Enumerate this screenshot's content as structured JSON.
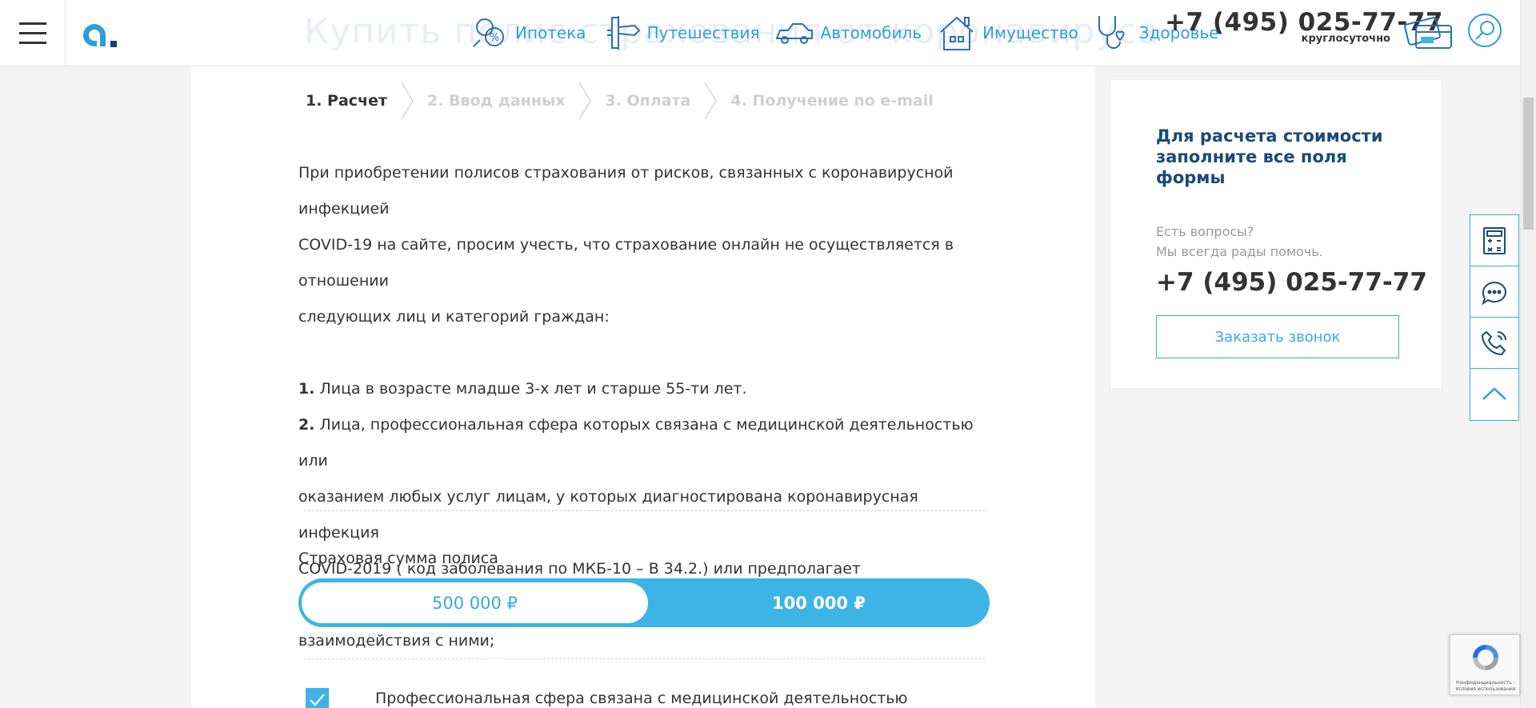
{
  "header": {
    "ghost_title": "Купить полис страхования от коронавируса",
    "nav": [
      {
        "label": "Ипотека",
        "icon": "mortgage-percent-icon"
      },
      {
        "label": "Путешествия",
        "icon": "airplane-icon"
      },
      {
        "label": "Автомобиль",
        "icon": "car-icon"
      },
      {
        "label": "Имущество",
        "icon": "house-icon"
      },
      {
        "label": "Здоровье",
        "icon": "stethoscope-icon"
      }
    ],
    "phone": "+7 (495) 025-77-77",
    "phone_sub": "круглосуточно"
  },
  "steps": [
    {
      "label": "1. Расчет",
      "active": true
    },
    {
      "label": "2. Ввод данных",
      "active": false
    },
    {
      "label": "3. Оплата",
      "active": false
    },
    {
      "label": "4. Получение по e-mail",
      "active": false
    }
  ],
  "notice": {
    "line1": "При приобретении полисов страхования от рисков, связанных с коронавирусной инфекцией",
    "line2": "COVID-19 на сайте, просим учесть, что страхование онлайн не осуществляется в отношении",
    "line3": "следующих лиц и категорий граждан:",
    "item1_num": "1.",
    "item1_text": " Лица в возрасте младше 3-х лет и старше 55-ти лет.",
    "item2_num": "2.",
    "item2_line1": " Лица, профессиональная сфера которых связана с медицинской деятельностью или",
    "item2_line2": "оказанием любых услуг лицам, у которых диагностирована коронавирусная инфекция",
    "item2_line3": "COVID-2019 ( код заболевания по МКБ-10 – B 34.2.) или предполагает непосредственного",
    "item2_line4": "взаимодействия с ними;"
  },
  "form": {
    "sum_label": "Страховая сумма полиса",
    "options": [
      "500 000 ₽",
      "100 000 ₽"
    ],
    "selected": "100 000 ₽",
    "checkbox_checked": true,
    "checkbox_label": "Профессиональная сфера связана с медицинской деятельностью"
  },
  "side": {
    "title": "Для расчета стоимости заполните все поля формы",
    "question_line1": "Есть вопросы?",
    "question_line2": "Мы всегда рады помочь.",
    "phone": "+7 (495) 025-77-77",
    "callback_label": "Заказать звонок"
  },
  "tools": [
    {
      "icon": "calculator-icon"
    },
    {
      "icon": "chat-icon"
    },
    {
      "icon": "phone-icon"
    },
    {
      "icon": "arrow-up-icon"
    }
  ],
  "recaptcha": {
    "text": "Конфиденциальность - Условия использования"
  },
  "colors": {
    "accent": "#3db4e5",
    "link": "#2c9fd8",
    "dark_blue": "#1a4a78",
    "text": "#333333"
  }
}
